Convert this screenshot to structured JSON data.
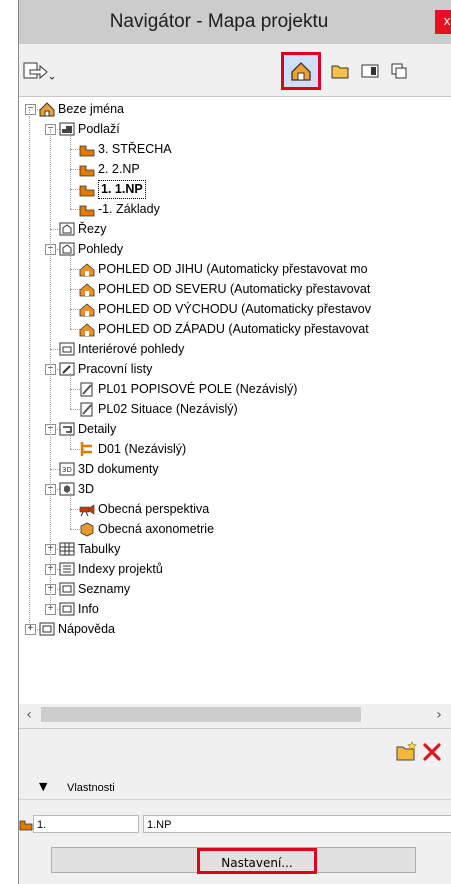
{
  "window": {
    "title": "Navigátor - Mapa projektu",
    "close_label": "x"
  },
  "tree": [
    {
      "label": "Beze jména"
    },
    {
      "label": "Podlaží"
    },
    {
      "label": "3. STŘECHA"
    },
    {
      "label": "2. 2.NP"
    },
    {
      "label": "1. 1.NP"
    },
    {
      "label": "-1. Základy"
    },
    {
      "label": "Řezy"
    },
    {
      "label": "Pohledy"
    },
    {
      "label": "POHLED OD JIHU (Automaticky přestavovat mo"
    },
    {
      "label": "POHLED OD SEVERU (Automaticky přestavovat"
    },
    {
      "label": "POHLED OD VÝCHODU (Automaticky přestavov"
    },
    {
      "label": "POHLED OD ZÁPADU (Automaticky přestavovat"
    },
    {
      "label": "Interiérové pohledy"
    },
    {
      "label": "Pracovní listy"
    },
    {
      "label": "PL01 POPISOVÉ POLE (Nezávislý)"
    },
    {
      "label": "PL02 Situace (Nezávislý)"
    },
    {
      "label": "Detaily"
    },
    {
      "label": "D01 (Nezávislý)"
    },
    {
      "label": "3D dokumenty"
    },
    {
      "label": "3D"
    },
    {
      "label": "Obecná perspektiva"
    },
    {
      "label": "Obecná axonometrie"
    },
    {
      "label": "Tabulky"
    },
    {
      "label": "Indexy projektů"
    },
    {
      "label": "Seznamy"
    },
    {
      "label": "Info"
    },
    {
      "label": "Nápověda"
    }
  ],
  "properties": {
    "header": "Vlastnosti",
    "id_value": "1.",
    "name_value": "1.NP",
    "settings_button": "Nastavení..."
  },
  "colors": {
    "highlight": "#e0001a",
    "folder_orange": "#e07b00",
    "close_red": "#e81123"
  }
}
